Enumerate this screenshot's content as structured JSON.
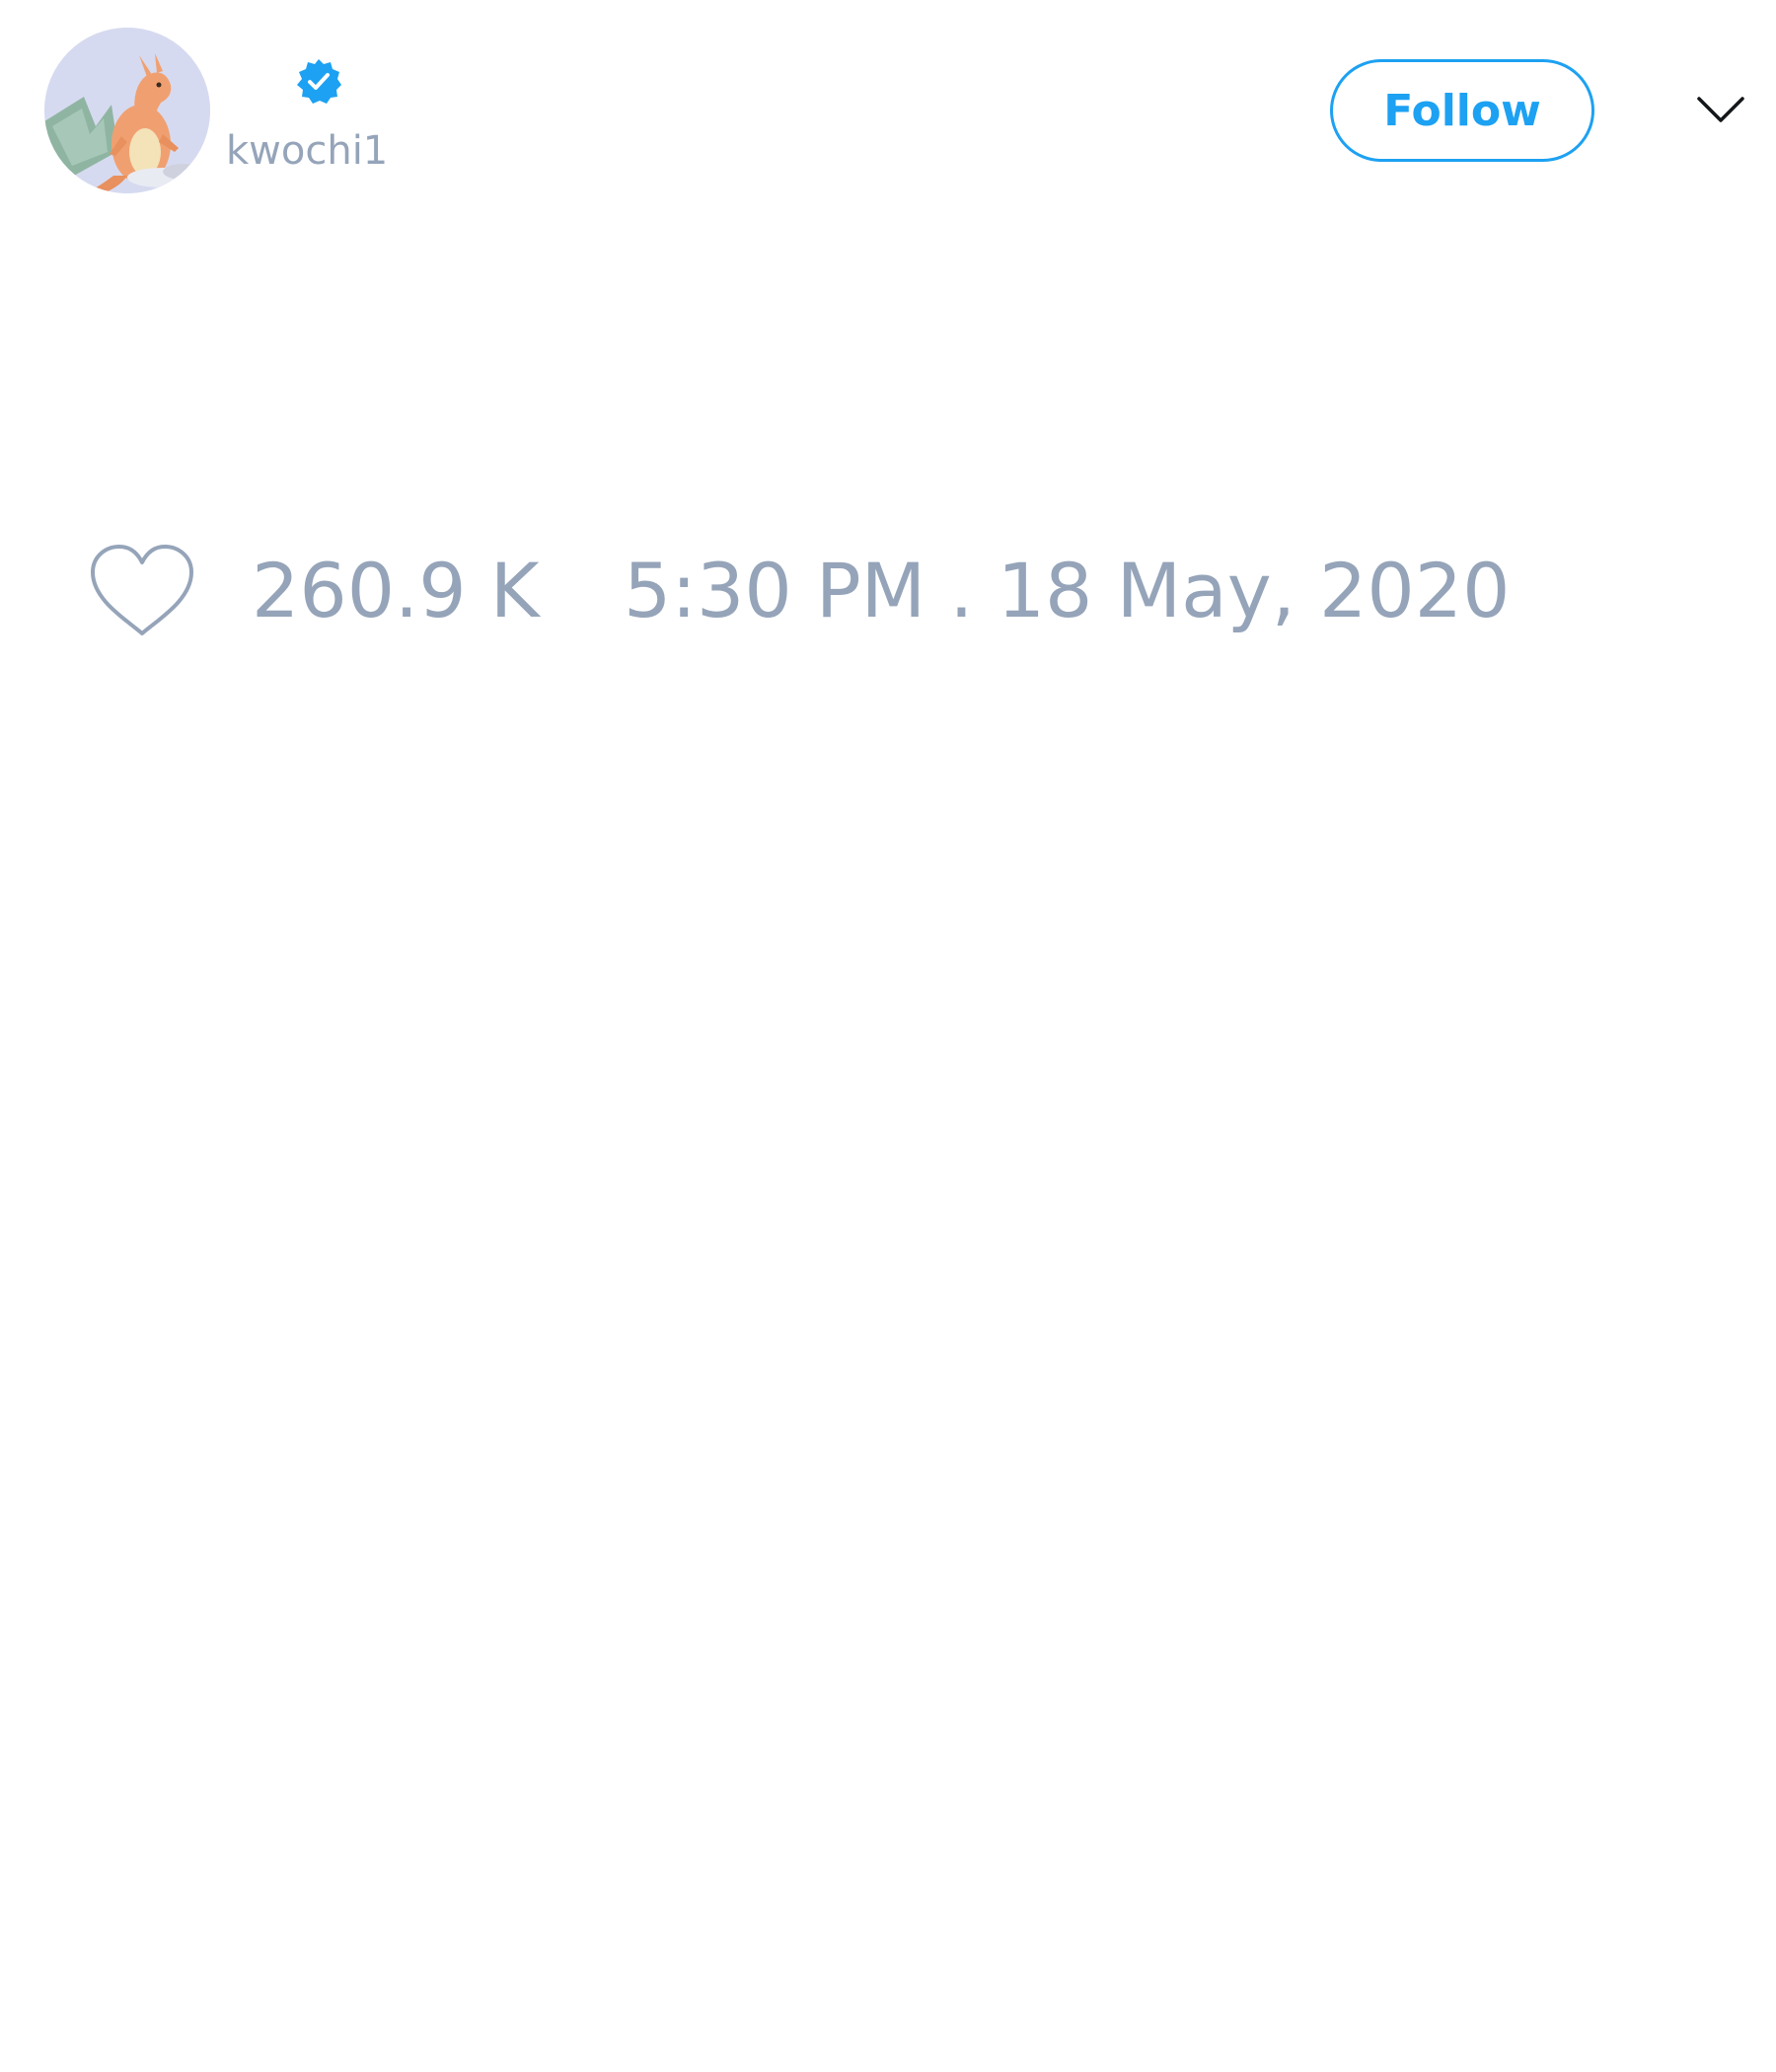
{
  "author": {
    "username": "kwochi1",
    "verified": true,
    "avatar_icon": "dragon-avatar-icon"
  },
  "actions": {
    "follow_label": "Follow",
    "menu_icon": "chevron-down-icon"
  },
  "tweet": {
    "like_icon": "heart-outline-icon",
    "like_count": "260.9 K",
    "timestamp": "5:30 PM . 18 May, 2020"
  },
  "colors": {
    "accent": "#1da1f2",
    "muted_text": "#95a4b9",
    "background": "#ffffff"
  }
}
